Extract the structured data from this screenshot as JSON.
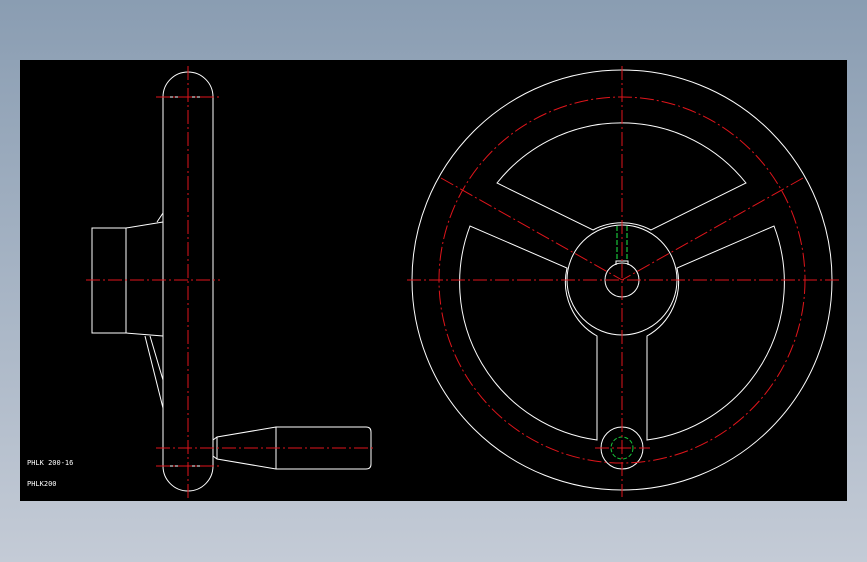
{
  "labels": {
    "model_code": "PHLK 200-16",
    "model_short": "PHLK200"
  },
  "colors": {
    "outline": "#ffffff",
    "centerline": "#e0151b",
    "hidden": "#19c43a",
    "canvas": "#000000"
  }
}
